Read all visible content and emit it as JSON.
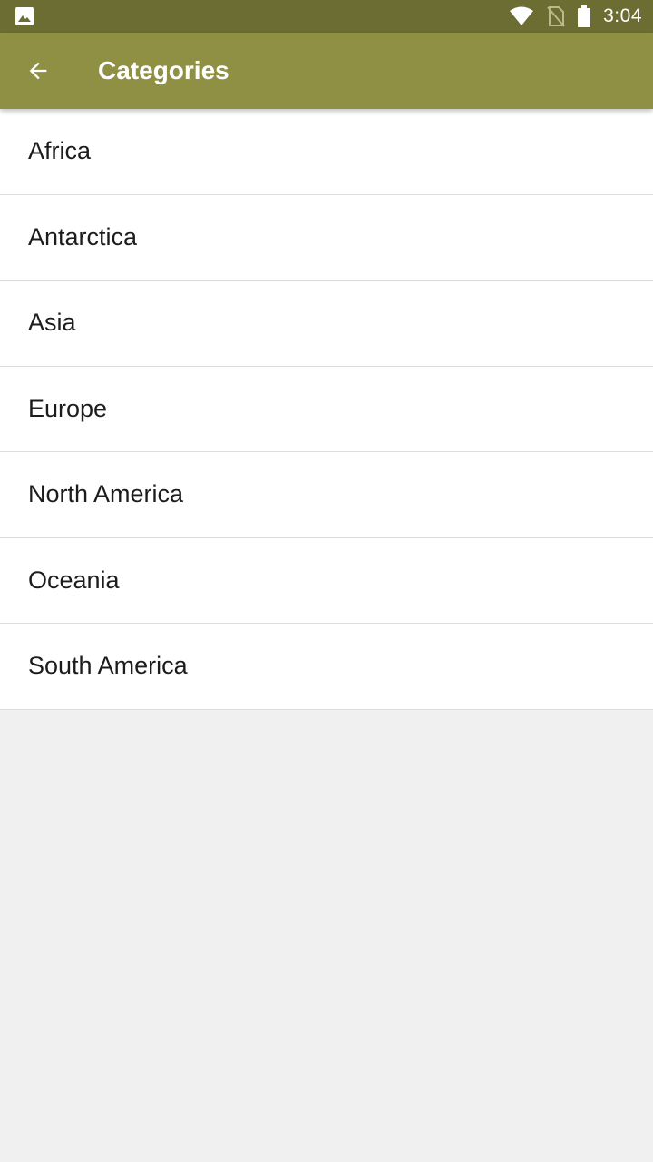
{
  "status_bar": {
    "time": "3:04",
    "icons": [
      "image-notification-icon",
      "wifi-icon",
      "no-sim-icon",
      "battery-icon"
    ]
  },
  "app_bar": {
    "title": "Categories",
    "back_icon": "arrow-back-icon"
  },
  "categories": [
    {
      "label": "Africa"
    },
    {
      "label": "Antarctica"
    },
    {
      "label": "Asia"
    },
    {
      "label": "Europe"
    },
    {
      "label": "North America"
    },
    {
      "label": "Oceania"
    },
    {
      "label": "South America"
    }
  ],
  "colors": {
    "status_bar": "#6b6d33",
    "app_bar": "#909045",
    "background": "#f0f0f0",
    "list_background": "#ffffff",
    "divider": "#dcdcdc"
  }
}
